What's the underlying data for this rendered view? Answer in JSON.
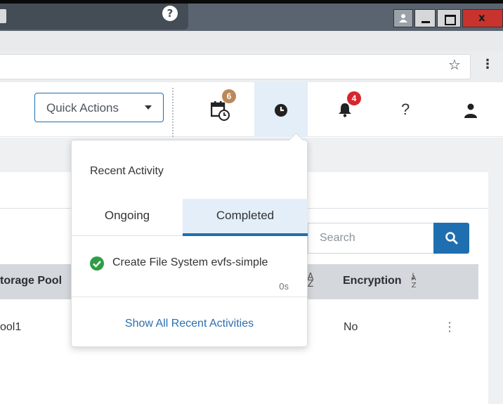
{
  "browser": {
    "tab_help_glyph": "?",
    "window_controls": {
      "close_glyph": "x"
    },
    "bookmark_icon": "star-icon",
    "menu_icon": "kebab-icon"
  },
  "header": {
    "quick_actions_label": "Quick Actions",
    "tasks_badge": "6",
    "alerts_badge": "4",
    "help_glyph": "?",
    "icons": [
      "calendar-clock-icon",
      "clock-icon",
      "bell-icon",
      "help-icon",
      "user-icon"
    ]
  },
  "recent_activity": {
    "title": "Recent Activity",
    "tabs": [
      {
        "label": "Ongoing",
        "active": false
      },
      {
        "label": "Completed",
        "active": true
      }
    ],
    "items": [
      {
        "status": "success",
        "name": "Create File System evfs-simple",
        "elapsed": "0s"
      }
    ],
    "show_all_label": "Show All Recent Activities"
  },
  "table": {
    "search_placeholder": "Search",
    "columns": [
      {
        "label": "torage Pool"
      },
      {
        "label": "Encryption"
      }
    ],
    "rows": [
      {
        "storage_pool": "ool1",
        "encryption": "No"
      }
    ]
  },
  "colors": {
    "accent": "#1f6fb0",
    "active_tab_bg": "#e3eef8",
    "success": "#2e9e44",
    "alert_badge": "#d7262e",
    "task_badge": "#b9895a"
  }
}
